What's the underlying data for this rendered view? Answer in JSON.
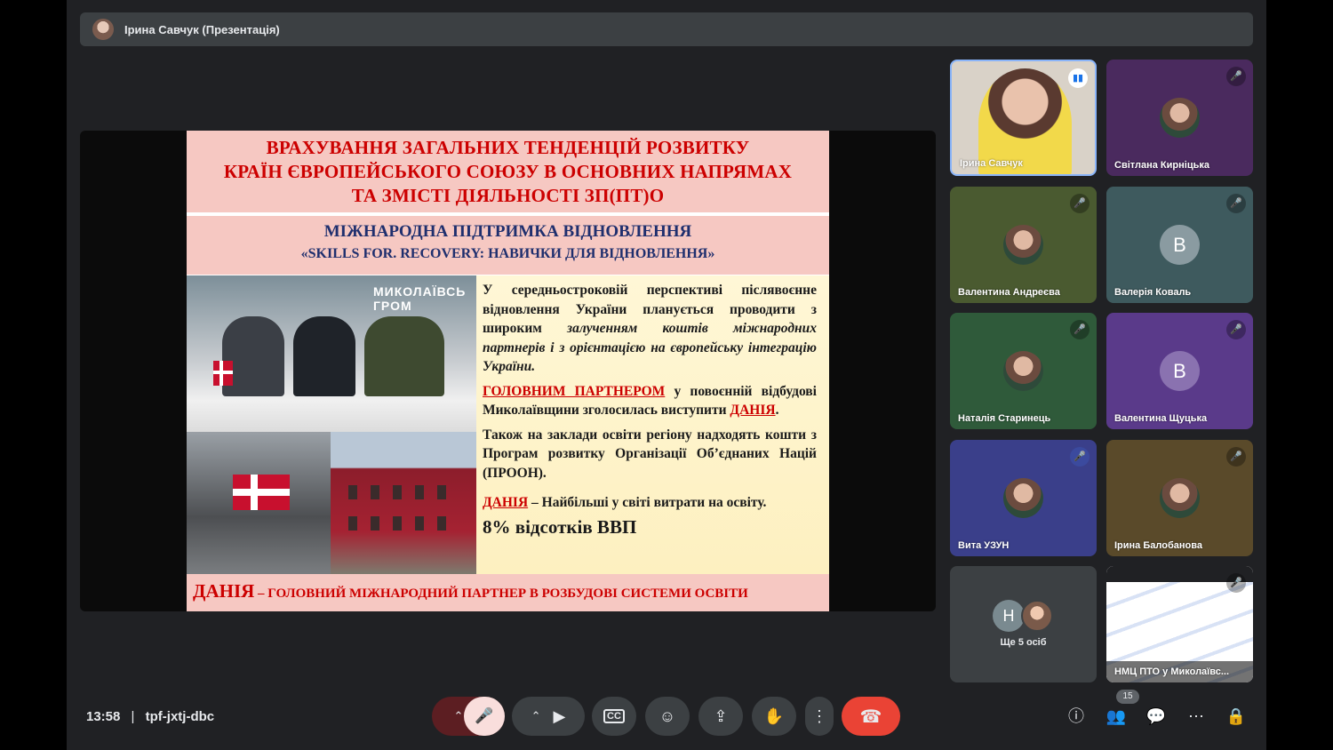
{
  "topbar": {
    "presenter": "Ірина Савчук (Презентація)"
  },
  "slide": {
    "title_lines": [
      "ВРАХУВАННЯ ЗАГАЛЬНИХ ТЕНДЕНЦІЙ РОЗВИТКУ",
      "КРАЇН ЄВРОПЕЙСЬКОГО СОЮЗУ В ОСНОВНИХ НАПРЯМАХ",
      "ТА ЗМІСТІ ДІЯЛЬНОСТІ ЗП(ПТ)О"
    ],
    "subtitle": "МІЖНАРОДНА ПІДТРИМКА ВІДНОВЛЕННЯ",
    "subtitle2": "«SKILLS FOR. RECOVERY: НАВИЧКИ ДЛЯ ВІДНОВЛЕННЯ»",
    "photo_sign": "МИКОЛАЇВСЬ ГРОМ",
    "p1_start": "У середньостроковій перспективі післявоєнне відновлення України планується проводити з широким ",
    "p1_em": "залученням коштів міжнародних партнерів і з орієнтацією на європейську інтеграцію України.",
    "p2_red": "ГОЛОВНИМ ПАРТНЕРОМ",
    "p2_mid": " у повоєнній відбудові Миколаївщини зголосилась виступити ",
    "p2_red2": "ДАНІЯ",
    "p2_end": ".",
    "p3": "Також на заклади освіти регіону надходять кошти з Програм розвитку Організації Об’єднаних Націй (ПРООН).",
    "p4_red": "ДАНІЯ",
    "p4_rest": " – Найбільші у світі витрати на освіту.",
    "p5": "8% відсотків ВВП",
    "footer_d": "ДАНІЯ",
    "footer_rest": " – ГОЛОВНИЙ МІЖНАРОДНИЙ ПАРТНЕР В РОЗБУДОВІ СИСТЕМИ ОСВІТИ"
  },
  "participants": [
    {
      "name": "Ірина Савчук"
    },
    {
      "name": "Світлана Кирніцька"
    },
    {
      "name": "Валентина Андреєва"
    },
    {
      "name": "Валерія Коваль",
      "initial": "В"
    },
    {
      "name": "Наталія Старинець"
    },
    {
      "name": "Валентина Щуцька",
      "initial": "В"
    },
    {
      "name": "Вита УЗУН"
    },
    {
      "name": "Ірина Балобанова"
    },
    {
      "name": "Ще 5 осіб",
      "initial": "Н"
    },
    {
      "name": "НМЦ ПТО у Миколаївс..."
    }
  ],
  "bottom": {
    "time": "13:58",
    "separator": "|",
    "meeting_code": "tpf-jxtj-dbc",
    "people_count": "15"
  },
  "colors": {
    "hangup": "#ea4335",
    "mic_off": "#f9dedc",
    "bg": "#202124"
  }
}
